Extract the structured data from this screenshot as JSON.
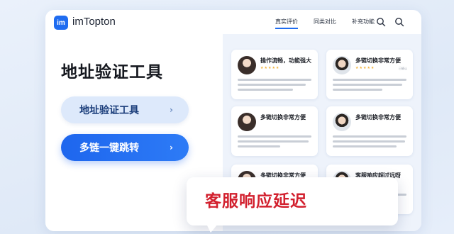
{
  "brand": {
    "logo_mark": "im",
    "name": "imTopton"
  },
  "nav": {
    "items": [
      "真实评价",
      "同类对比",
      "补充功能"
    ],
    "active": 0
  },
  "header_icons": [
    "search-icon",
    "search-icon"
  ],
  "hero": {
    "title": "地址验证工具"
  },
  "buttons": {
    "primary_light": "地址验证工具",
    "primary_dark": "多链一键跳转"
  },
  "reviews": [
    {
      "name": "操作流畅，功能强大",
      "avatar": "female",
      "stars": "★★★★★",
      "date": ""
    },
    {
      "name": "多链切换非常方便",
      "avatar": "male",
      "stars": "★★★★★",
      "date": "已确认"
    },
    {
      "name": "多链切换非常方便",
      "avatar": "female",
      "stars": "",
      "date": ""
    },
    {
      "name": "多链切换非常方便",
      "avatar": "male",
      "stars": "",
      "date": ""
    },
    {
      "name": "多链切换非常方便",
      "avatar": "female",
      "stars": "",
      "date": ""
    },
    {
      "name": "客服响应超过远呀",
      "avatar": "male",
      "stars": "",
      "date": ""
    }
  ],
  "callout": {
    "text": "客服响应延迟"
  },
  "colors": {
    "accent": "#1f6cf0",
    "warning": "#d2202e",
    "star": "#f2b33a"
  }
}
